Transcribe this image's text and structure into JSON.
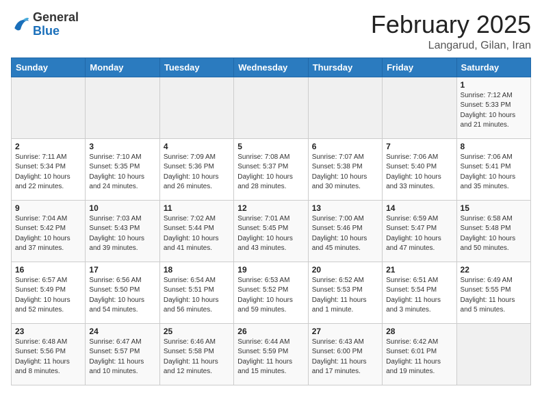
{
  "logo": {
    "general": "General",
    "blue": "Blue"
  },
  "header": {
    "month_year": "February 2025",
    "location": "Langarud, Gilan, Iran"
  },
  "days_of_week": [
    "Sunday",
    "Monday",
    "Tuesday",
    "Wednesday",
    "Thursday",
    "Friday",
    "Saturday"
  ],
  "weeks": [
    [
      {
        "day": "",
        "info": ""
      },
      {
        "day": "",
        "info": ""
      },
      {
        "day": "",
        "info": ""
      },
      {
        "day": "",
        "info": ""
      },
      {
        "day": "",
        "info": ""
      },
      {
        "day": "",
        "info": ""
      },
      {
        "day": "1",
        "info": "Sunrise: 7:12 AM\nSunset: 5:33 PM\nDaylight: 10 hours and 21 minutes."
      }
    ],
    [
      {
        "day": "2",
        "info": "Sunrise: 7:11 AM\nSunset: 5:34 PM\nDaylight: 10 hours and 22 minutes."
      },
      {
        "day": "3",
        "info": "Sunrise: 7:10 AM\nSunset: 5:35 PM\nDaylight: 10 hours and 24 minutes."
      },
      {
        "day": "4",
        "info": "Sunrise: 7:09 AM\nSunset: 5:36 PM\nDaylight: 10 hours and 26 minutes."
      },
      {
        "day": "5",
        "info": "Sunrise: 7:08 AM\nSunset: 5:37 PM\nDaylight: 10 hours and 28 minutes."
      },
      {
        "day": "6",
        "info": "Sunrise: 7:07 AM\nSunset: 5:38 PM\nDaylight: 10 hours and 30 minutes."
      },
      {
        "day": "7",
        "info": "Sunrise: 7:06 AM\nSunset: 5:40 PM\nDaylight: 10 hours and 33 minutes."
      },
      {
        "day": "8",
        "info": "Sunrise: 7:06 AM\nSunset: 5:41 PM\nDaylight: 10 hours and 35 minutes."
      }
    ],
    [
      {
        "day": "9",
        "info": "Sunrise: 7:04 AM\nSunset: 5:42 PM\nDaylight: 10 hours and 37 minutes."
      },
      {
        "day": "10",
        "info": "Sunrise: 7:03 AM\nSunset: 5:43 PM\nDaylight: 10 hours and 39 minutes."
      },
      {
        "day": "11",
        "info": "Sunrise: 7:02 AM\nSunset: 5:44 PM\nDaylight: 10 hours and 41 minutes."
      },
      {
        "day": "12",
        "info": "Sunrise: 7:01 AM\nSunset: 5:45 PM\nDaylight: 10 hours and 43 minutes."
      },
      {
        "day": "13",
        "info": "Sunrise: 7:00 AM\nSunset: 5:46 PM\nDaylight: 10 hours and 45 minutes."
      },
      {
        "day": "14",
        "info": "Sunrise: 6:59 AM\nSunset: 5:47 PM\nDaylight: 10 hours and 47 minutes."
      },
      {
        "day": "15",
        "info": "Sunrise: 6:58 AM\nSunset: 5:48 PM\nDaylight: 10 hours and 50 minutes."
      }
    ],
    [
      {
        "day": "16",
        "info": "Sunrise: 6:57 AM\nSunset: 5:49 PM\nDaylight: 10 hours and 52 minutes."
      },
      {
        "day": "17",
        "info": "Sunrise: 6:56 AM\nSunset: 5:50 PM\nDaylight: 10 hours and 54 minutes."
      },
      {
        "day": "18",
        "info": "Sunrise: 6:54 AM\nSunset: 5:51 PM\nDaylight: 10 hours and 56 minutes."
      },
      {
        "day": "19",
        "info": "Sunrise: 6:53 AM\nSunset: 5:52 PM\nDaylight: 10 hours and 59 minutes."
      },
      {
        "day": "20",
        "info": "Sunrise: 6:52 AM\nSunset: 5:53 PM\nDaylight: 11 hours and 1 minute."
      },
      {
        "day": "21",
        "info": "Sunrise: 6:51 AM\nSunset: 5:54 PM\nDaylight: 11 hours and 3 minutes."
      },
      {
        "day": "22",
        "info": "Sunrise: 6:49 AM\nSunset: 5:55 PM\nDaylight: 11 hours and 5 minutes."
      }
    ],
    [
      {
        "day": "23",
        "info": "Sunrise: 6:48 AM\nSunset: 5:56 PM\nDaylight: 11 hours and 8 minutes."
      },
      {
        "day": "24",
        "info": "Sunrise: 6:47 AM\nSunset: 5:57 PM\nDaylight: 11 hours and 10 minutes."
      },
      {
        "day": "25",
        "info": "Sunrise: 6:46 AM\nSunset: 5:58 PM\nDaylight: 11 hours and 12 minutes."
      },
      {
        "day": "26",
        "info": "Sunrise: 6:44 AM\nSunset: 5:59 PM\nDaylight: 11 hours and 15 minutes."
      },
      {
        "day": "27",
        "info": "Sunrise: 6:43 AM\nSunset: 6:00 PM\nDaylight: 11 hours and 17 minutes."
      },
      {
        "day": "28",
        "info": "Sunrise: 6:42 AM\nSunset: 6:01 PM\nDaylight: 11 hours and 19 minutes."
      },
      {
        "day": "",
        "info": ""
      }
    ]
  ]
}
